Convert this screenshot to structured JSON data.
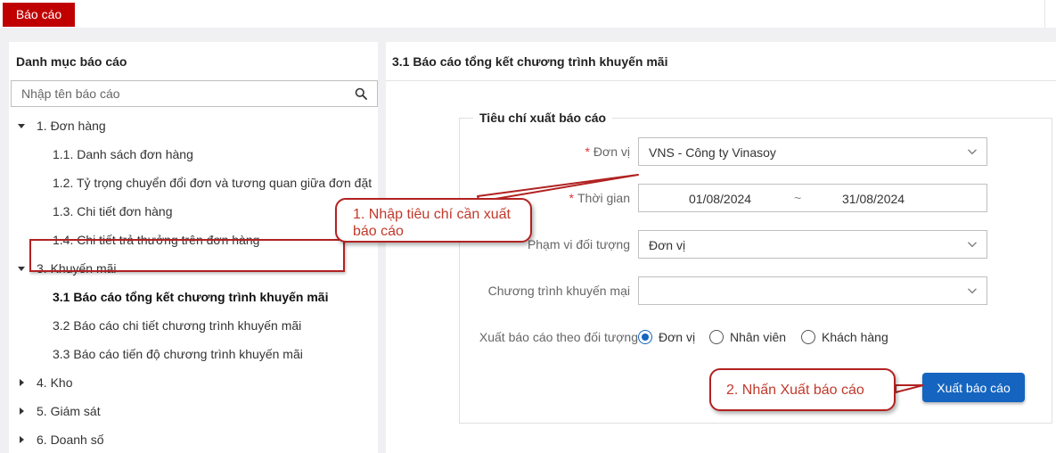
{
  "top_tab": {
    "label": "Báo cáo"
  },
  "sidebar": {
    "title": "Danh mục báo cáo",
    "search_placeholder": "Nhập tên báo cáo",
    "items": [
      {
        "label": "1. Đơn hàng",
        "level": 1,
        "expanded": true
      },
      {
        "label": "1.1. Danh sách đơn hàng",
        "level": 2
      },
      {
        "label": "1.2. Tỷ trọng chuyển đổi đơn và tương quan giữa đơn đặt",
        "level": 2
      },
      {
        "label": "1.3. Chi tiết đơn hàng",
        "level": 2
      },
      {
        "label": "1.4. Chi tiết trả thưởng trên đơn hàng",
        "level": 2
      },
      {
        "label": "3. Khuyến mãi",
        "level": 1,
        "expanded": true
      },
      {
        "label": "3.1 Báo cáo tổng kết chương trình khuyến mãi",
        "level": 2,
        "selected": true
      },
      {
        "label": "3.2 Báo cáo chi tiết chương trình khuyến mãi",
        "level": 2
      },
      {
        "label": "3.3 Báo cáo tiến độ chương trình khuyến mãi",
        "level": 2
      },
      {
        "label": "4. Kho",
        "level": 1,
        "expanded": false
      },
      {
        "label": "5. Giám sát",
        "level": 1,
        "expanded": false
      },
      {
        "label": "6. Doanh số",
        "level": 1,
        "expanded": false
      }
    ]
  },
  "main": {
    "title": "3.1 Báo cáo tổng kết chương trình khuyến mãi",
    "criteria_title": "Tiêu chí xuất báo cáo",
    "unit": {
      "label": "Đơn vị",
      "required": true,
      "value": "VNS - Công ty Vinasoy"
    },
    "time": {
      "label": "Thời gian",
      "required": true,
      "from": "01/08/2024",
      "separator": "~",
      "to": "31/08/2024"
    },
    "scope": {
      "label": "Phạm vi đối tượng",
      "value": "Đơn vị"
    },
    "program": {
      "label": "Chương trình khuyến mại",
      "value": ""
    },
    "export_by": {
      "label": "Xuất báo cáo theo đối tượng",
      "options": [
        {
          "label": "Đơn vị",
          "checked": true
        },
        {
          "label": "Nhân viên",
          "checked": false
        },
        {
          "label": "Khách hàng",
          "checked": false
        }
      ]
    },
    "export_button": "Xuất báo cáo"
  },
  "annotations": {
    "step1_line1": "1. Nhập tiêu chí cần xuất",
    "step1_line2": "báo cáo",
    "step2": "2. Nhấn Xuất báo cáo"
  },
  "colors": {
    "brand_red": "#c00000",
    "primary_blue": "#1565c0",
    "callout_border": "#b22222",
    "callout_text": "#c0392b",
    "required_star": "#e03030"
  }
}
